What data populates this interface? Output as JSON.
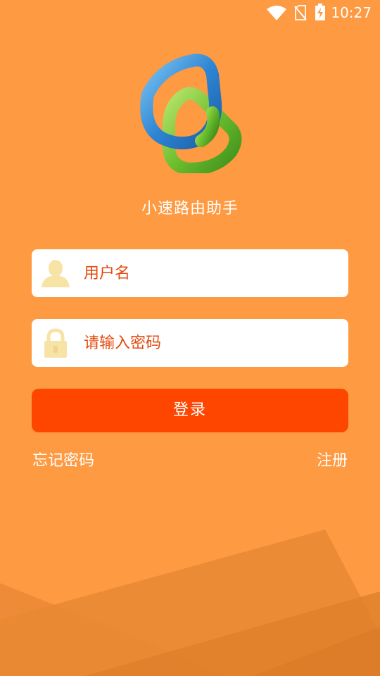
{
  "status_bar": {
    "time": "10:27",
    "icons": [
      "wifi-icon",
      "no-sim-icon",
      "battery-charging-icon"
    ]
  },
  "app": {
    "name": "小速路由助手",
    "logo": "app-logo-triangles"
  },
  "login_form": {
    "username_placeholder": "用户名",
    "password_placeholder": "请输入密码",
    "username_icon": "user-icon",
    "password_icon": "lock-icon",
    "login_button": "登录",
    "forgot_password": "忘记密码",
    "register": "注册"
  },
  "colors": {
    "background": "#fd9a42",
    "button": "#fe4600",
    "placeholder": "#e34a0e",
    "icon": "#f8e3a6"
  }
}
